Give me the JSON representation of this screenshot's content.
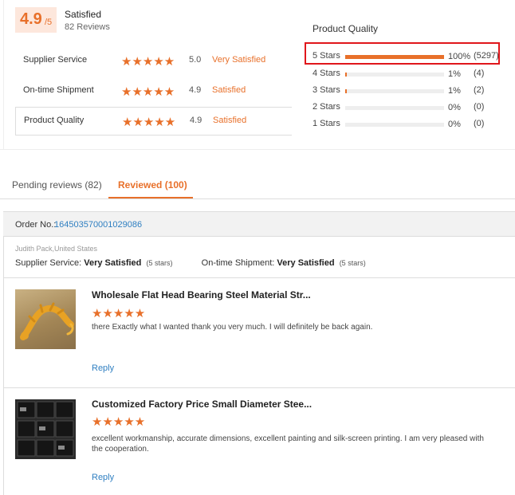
{
  "summary": {
    "score": "4.9",
    "score_max": "/5",
    "label": "Satisfied",
    "reviews_count": "82 Reviews",
    "ratings": [
      {
        "label": "Supplier Service",
        "stars": "★★★★★",
        "score": "5.0",
        "verdict": "Very Satisfied"
      },
      {
        "label": "On-time Shipment",
        "stars": "★★★★★",
        "score": "4.9",
        "verdict": "Satisfied"
      },
      {
        "label": "Product Quality",
        "stars": "★★★★★",
        "score": "4.9",
        "verdict": "Satisfied"
      }
    ]
  },
  "product_quality": {
    "title": "Product Quality",
    "distribution": [
      {
        "label": "5 Stars",
        "fraction": 1.0,
        "percent": "100%",
        "count": "(5297)"
      },
      {
        "label": "4 Stars",
        "fraction": 0.01,
        "percent": "1%",
        "count": "(4)"
      },
      {
        "label": "3 Stars",
        "fraction": 0.01,
        "percent": "1%",
        "count": "(2)"
      },
      {
        "label": "2 Stars",
        "fraction": 0.0,
        "percent": "0%",
        "count": "(0)"
      },
      {
        "label": "1 Stars",
        "fraction": 0.0,
        "percent": "0%",
        "count": "(0)"
      }
    ]
  },
  "tabs": [
    {
      "label": "Pending reviews (82)"
    },
    {
      "label": "Reviewed (100)"
    }
  ],
  "order": {
    "label": "Order No.:",
    "number": "164503570001029086",
    "buyer": "Judith Pack,United States",
    "supplier_service_label": "Supplier Service:",
    "supplier_service_value": "Very Satisfied",
    "supplier_service_stars": "(5 stars)",
    "shipment_label": "On-time Shipment:",
    "shipment_value": "Very Satisfied",
    "shipment_stars": "(5 stars)"
  },
  "reviews": [
    {
      "title": "Wholesale Flat Head Bearing Steel Material Str...",
      "stars": "★★★★★",
      "text": "there Exactly what I wanted thank you very much. I will definitely be back again.",
      "reply": "Reply"
    },
    {
      "title": "Customized Factory Price Small Diameter Stee...",
      "stars": "★★★★★",
      "text": "excellent workmanship, accurate dimensions, excellent painting and silk-screen printing. I am very pleased with the cooperation.",
      "reply": "Reply"
    }
  ],
  "colors": {
    "accent": "#e8702a",
    "link": "#2f7fc1",
    "highlight_box": "#e0161b"
  },
  "icons": [
    "star-icon"
  ]
}
